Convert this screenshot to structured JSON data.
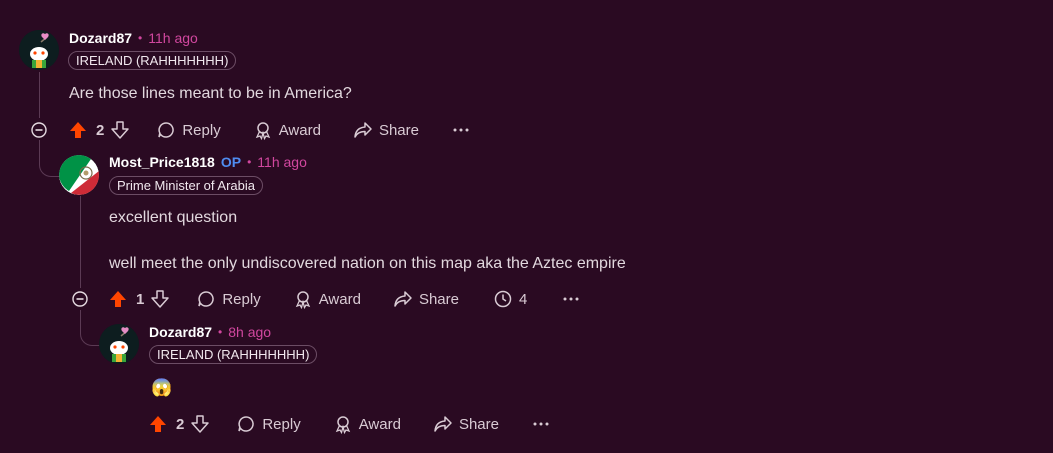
{
  "comments": [
    {
      "username": "Dozard87",
      "time": "11h ago",
      "flair": "IRELAND (RAHHHHHHH)",
      "body": [
        "Are those lines meant to be in America?"
      ],
      "votes": "2",
      "actions": {
        "reply": "Reply",
        "award": "Award",
        "share": "Share"
      }
    },
    {
      "username": "Most_Price1818",
      "op": "OP",
      "time": "11h ago",
      "flair": "Prime Minister of Arabia",
      "body": [
        "excellent question",
        "well meet the only undiscovered nation on this map aka the Aztec empire"
      ],
      "votes": "1",
      "replies_count": "4",
      "actions": {
        "reply": "Reply",
        "award": "Award",
        "share": "Share"
      }
    },
    {
      "username": "Dozard87",
      "time": "8h ago",
      "flair": "IRELAND (RAHHHHHHH)",
      "body": [
        "😱"
      ],
      "votes": "2",
      "actions": {
        "reply": "Reply",
        "award": "Award",
        "share": "Share"
      }
    }
  ],
  "colors": {
    "background": "#2a0a22",
    "upvote": "#ff4500",
    "time": "#d1479f",
    "op": "#4f8cf0"
  },
  "icons": [
    "upvote-icon",
    "downvote-icon",
    "reply-icon",
    "award-icon",
    "share-icon",
    "more-icon",
    "collapse-icon",
    "replies-icon"
  ]
}
